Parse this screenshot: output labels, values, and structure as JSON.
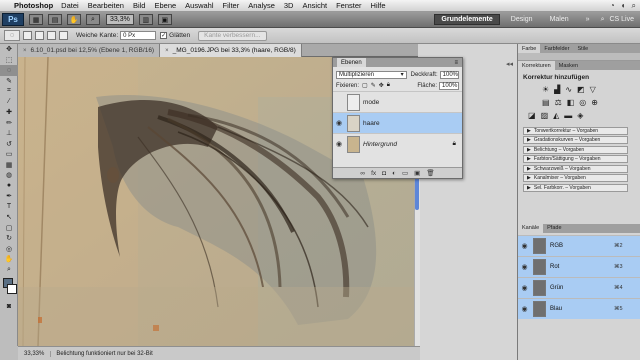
{
  "menubar": {
    "app_name": "Photoshop",
    "items": [
      "Datei",
      "Bearbeiten",
      "Bild",
      "Ebene",
      "Auswahl",
      "Filter",
      "Analyse",
      "3D",
      "Ansicht",
      "Fenster",
      "Hilfe"
    ]
  },
  "appbar": {
    "logo": "Ps",
    "zoom": "33,3%",
    "workspaces": {
      "active": "Grundelemente",
      "others": [
        "Design",
        "Malen"
      ]
    },
    "cs_live": "CS Live"
  },
  "options": {
    "feather_label": "Weiche Kante:",
    "feather_value": "0 Px",
    "antialias_label": "Glätten",
    "refine_button": "Kante verbessern..."
  },
  "tabs": [
    {
      "label": "6.10_01.psd bei 12,5% (Ebene 1, RGB/16)",
      "active": false
    },
    {
      "label": "_MG_0196.JPG bei 33,3% (haare, RGB/8)",
      "active": true
    }
  ],
  "window_title": "_MG_0196.JPG bei 33,3% (haare, RGB/8) *",
  "status": {
    "zoom": "33,33%",
    "message": "Belichtung funktioniert nur bei 32-Bit"
  },
  "layers_panel": {
    "tab": "Ebenen",
    "blend_mode": "Multiplizieren",
    "opacity_label": "Deckkraft:",
    "opacity": "100%",
    "lock_label": "Fixieren:",
    "fill_label": "Fläche:",
    "fill": "100%",
    "layers": [
      {
        "name": "mode",
        "selected": false,
        "visible": false
      },
      {
        "name": "haare",
        "selected": true,
        "visible": true
      },
      {
        "name": "Hintergrund",
        "selected": false,
        "visible": true,
        "locked": true
      }
    ]
  },
  "right_panel": {
    "tabs1": [
      "Farbe",
      "Farbfelder",
      "Stile"
    ],
    "tabs2": [
      "Korrekturen",
      "Masken"
    ],
    "korrektur_title": "Korrektur hinzufügen",
    "presets": [
      "Tonwertkorrektur – Vorgaben",
      "Gradationskurven – Vorgaben",
      "Belichtung – Vorgaben",
      "Farbton/Sättigung – Vorgaben",
      "Schwarzweiß – Vorgaben",
      "Kanalmixer – Vorgaben",
      "Sel. Farbkorr. – Vorgaben"
    ],
    "channel_tabs": [
      "Kanäle",
      "Pfade"
    ],
    "channels": [
      {
        "name": "RGB",
        "key": "⌘2"
      },
      {
        "name": "Rot",
        "key": "⌘3"
      },
      {
        "name": "Grün",
        "key": "⌘4"
      },
      {
        "name": "Blau",
        "key": "⌘5"
      }
    ]
  },
  "colors": {
    "selection_blue": "#a9ccf3",
    "accent": "#5d86d8"
  }
}
